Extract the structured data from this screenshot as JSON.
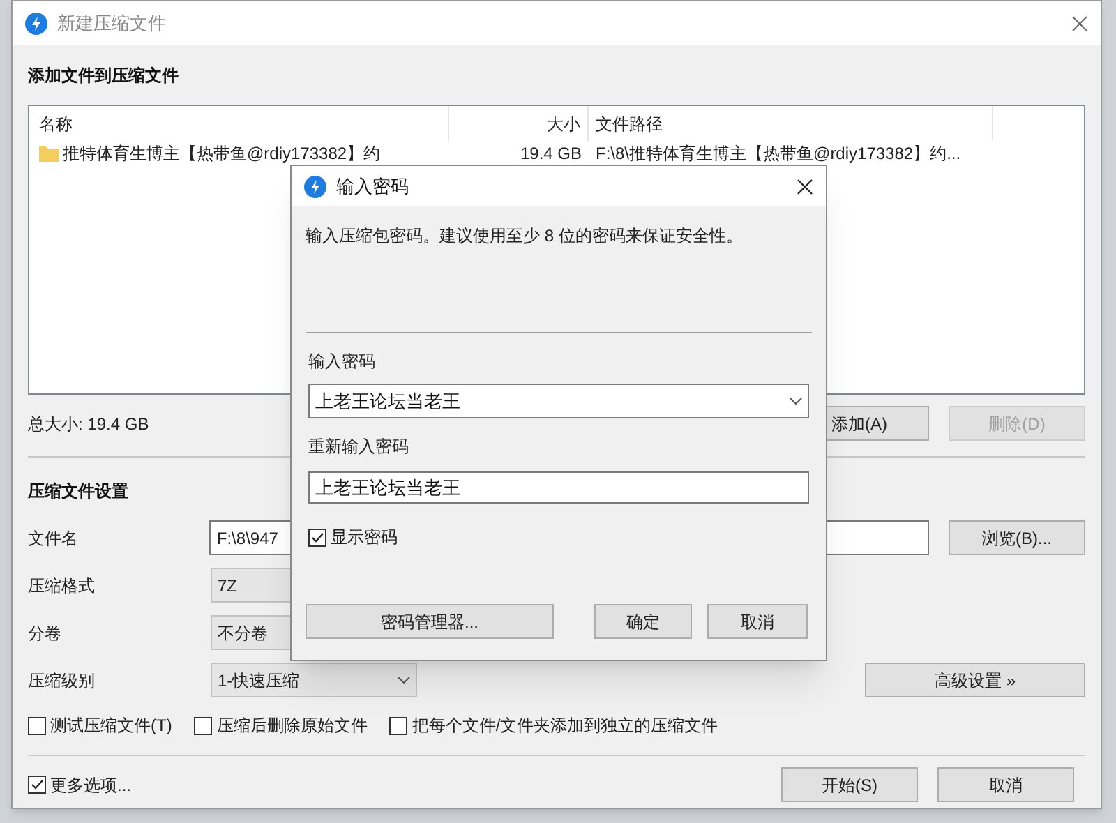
{
  "window": {
    "title": "新建压缩文件"
  },
  "add_section": {
    "heading": "添加文件到压缩文件"
  },
  "file_list": {
    "columns": [
      "名称",
      "大小",
      "文件路径"
    ],
    "rows": [
      {
        "name": "推特体育生博主【热带鱼@rdiy173382】约",
        "size": "19.4 GB",
        "path": "F:\\8\\推特体育生博主【热带鱼@rdiy173382】约..."
      }
    ]
  },
  "total_size": "总大小: 19.4 GB",
  "list_buttons": [
    {
      "label": "添加(A)",
      "disabled": false
    },
    {
      "label": "删除(D)",
      "disabled": true
    }
  ],
  "settings": {
    "heading": "压缩文件设置",
    "filename": {
      "label": "文件名",
      "value": "F:\\8\\947",
      "button": "浏览(B)..."
    },
    "format": {
      "label": "压缩格式",
      "value": "7Z"
    },
    "split": {
      "label": "分卷",
      "value": "不分卷"
    },
    "level": {
      "label": "压缩级别",
      "value": "1-快速压缩",
      "button": "高级设置 »"
    },
    "options": [
      {
        "label": "测试压缩文件(T)",
        "checked": false
      },
      {
        "label": "压缩后删除原始文件",
        "checked": false
      },
      {
        "label": "把每个文件/文件夹添加到独立的压缩文件",
        "checked": false
      }
    ]
  },
  "more_options": {
    "label": "更多选项...",
    "checked": true
  },
  "footer_buttons": [
    "开始(S)",
    "取消"
  ],
  "password_dialog": {
    "title": "输入密码",
    "message": "输入压缩包密码。建议使用至少 8 位的密码来保证安全性。",
    "password_label": "输入密码",
    "password_value": "上老王论坛当老王",
    "confirm_label": "重新输入密码",
    "confirm_value": "上老王论坛当老王",
    "show_password": {
      "label": "显示密码",
      "checked": true
    },
    "manager_button": "密码管理器...",
    "ok_button": "确定",
    "cancel_button": "取消"
  }
}
